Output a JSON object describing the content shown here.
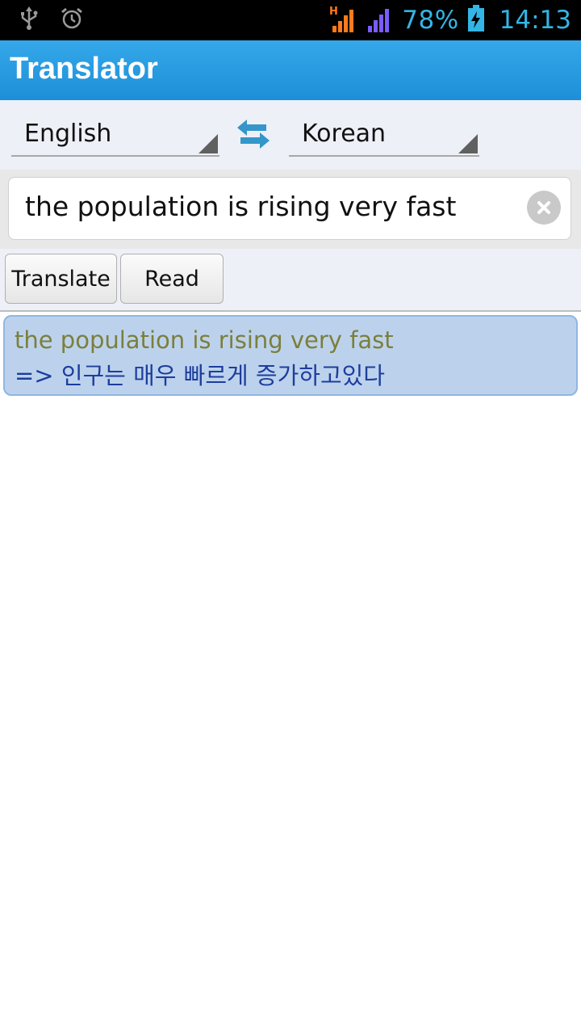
{
  "status_bar": {
    "icons_left": [
      "usb-icon",
      "alarm-clock-icon"
    ],
    "network_type": "H",
    "battery_percent": "78%",
    "time": "14:13",
    "accent_color": "#33b5e5"
  },
  "app": {
    "title": "Translator",
    "header_color": "#2a9fe3"
  },
  "language": {
    "source": "English",
    "target": "Korean",
    "swap_icon": "swap-arrows-icon"
  },
  "input": {
    "text": "the population is rising very fast",
    "clear_icon": "clear-icon"
  },
  "buttons": {
    "translate": "Translate",
    "read": "Read"
  },
  "result": {
    "source_text": "the population is rising very fast",
    "translation": " => 인구는 매우 빠르게 증가하고있다"
  }
}
